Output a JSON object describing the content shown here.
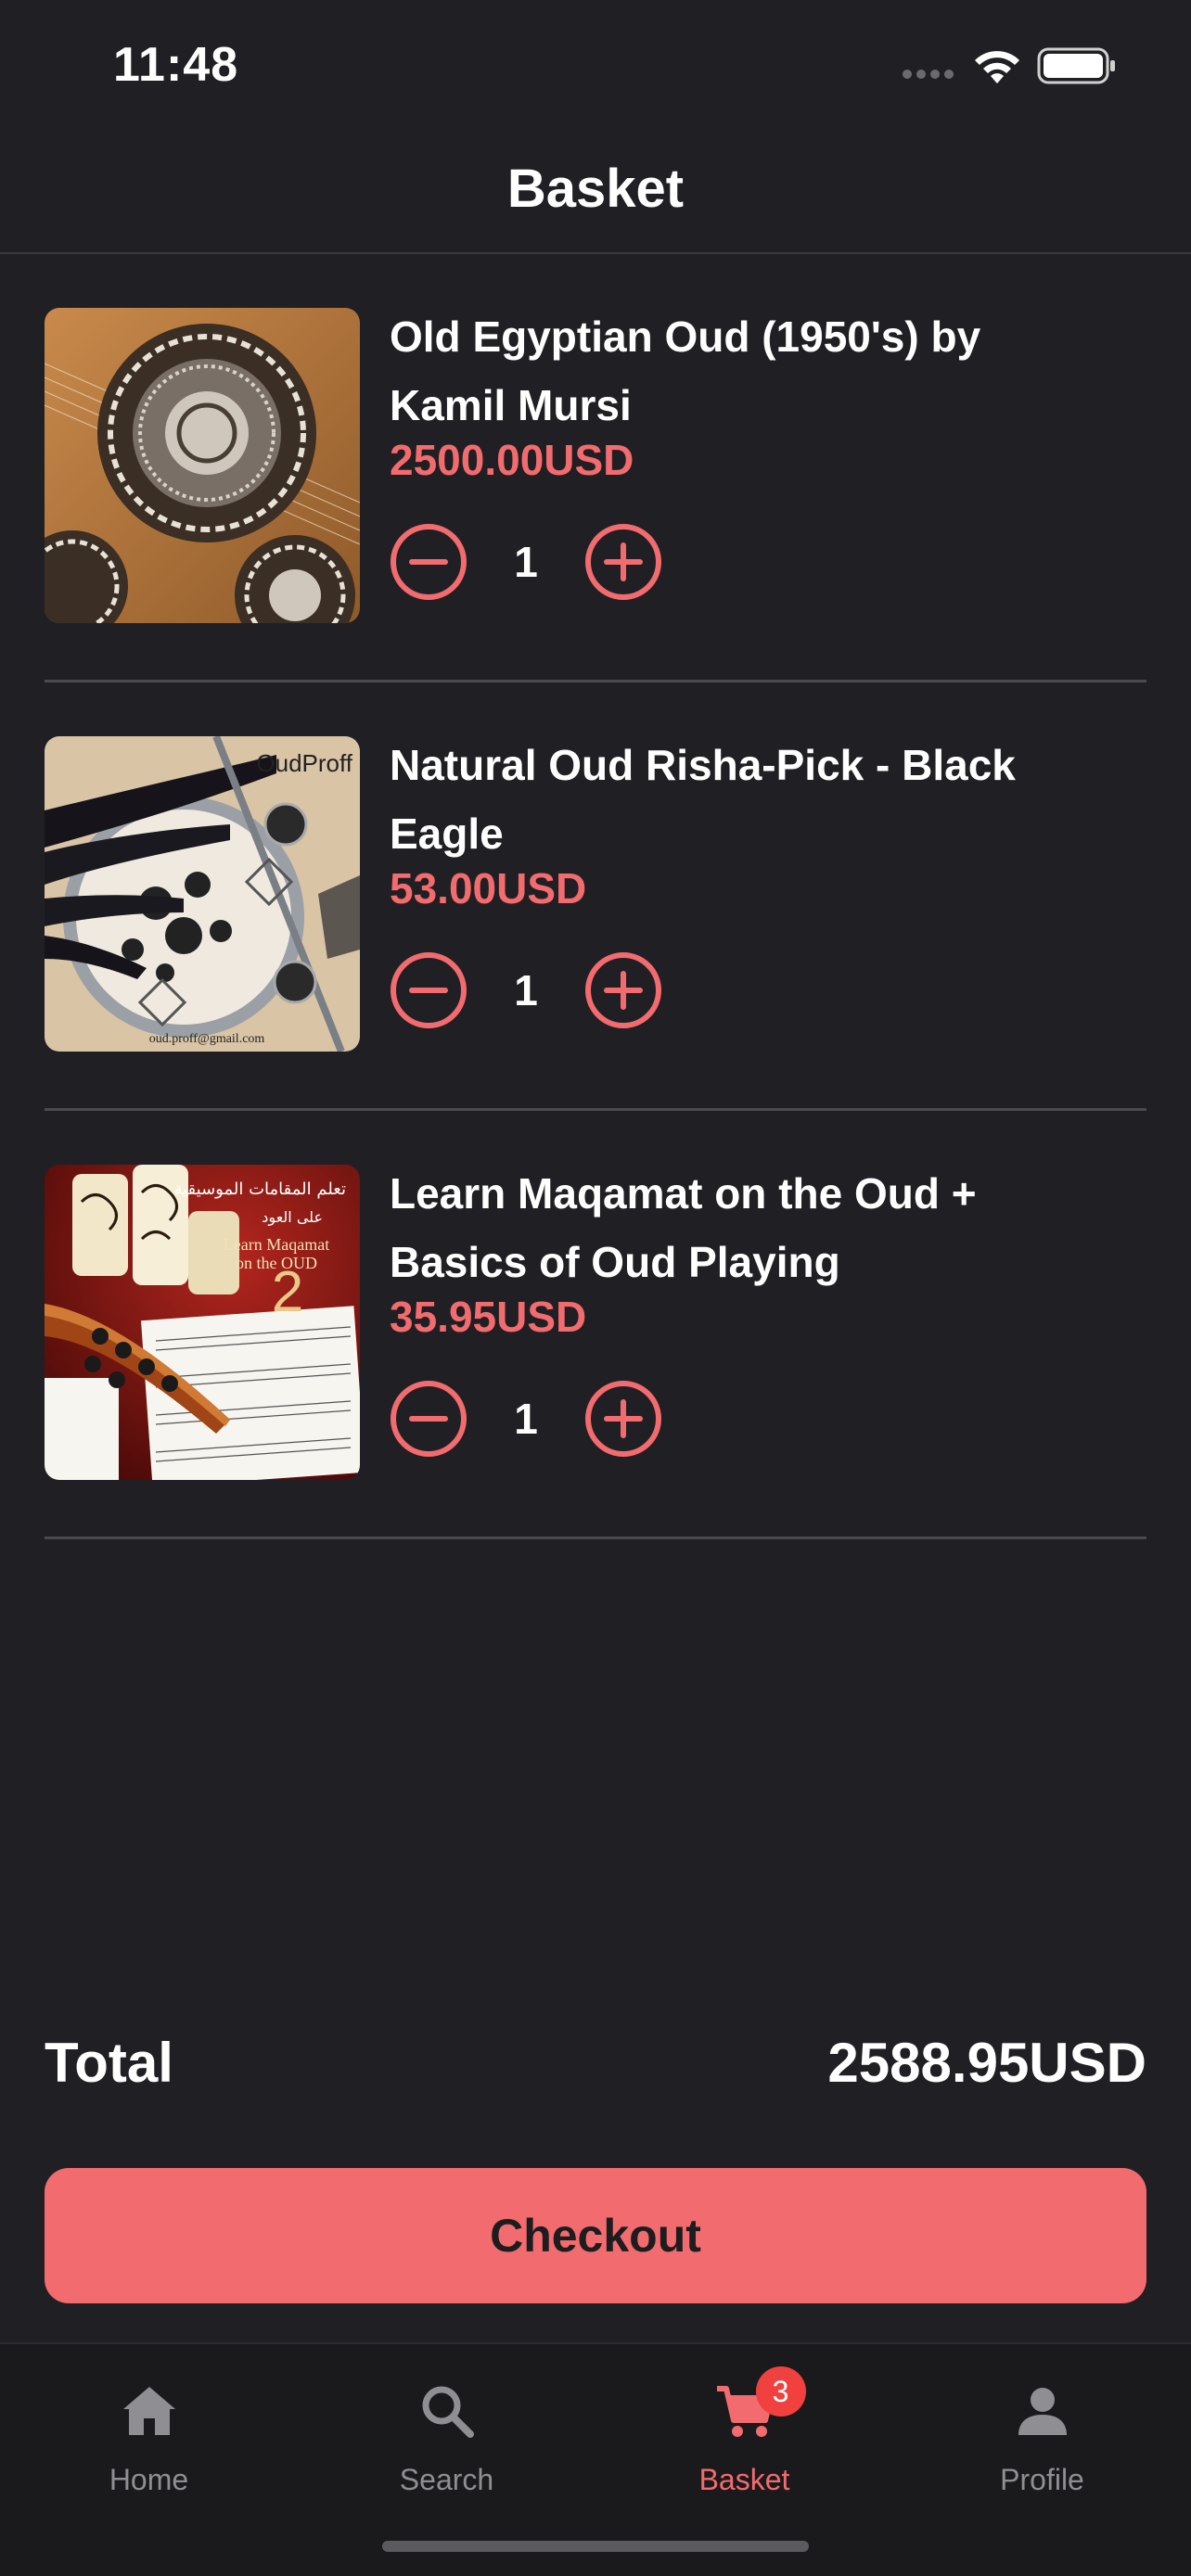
{
  "status_bar": {
    "time": "11:48",
    "icons": [
      "cellular-signal-icon",
      "wifi-icon",
      "battery-icon"
    ]
  },
  "header": {
    "title": "Basket"
  },
  "items": [
    {
      "title": "Old Egyptian Oud (1950's) by Kamil Mursi",
      "price": "2500.00USD",
      "quantity": "1",
      "image": "oud-inlay-photo"
    },
    {
      "title": "Natural Oud Risha-Pick - Black Eagle",
      "price": "53.00USD",
      "quantity": "1",
      "image": "risha-pick-photo",
      "image_watermark": "OudProff",
      "image_caption": "oud.proff@gmail.com"
    },
    {
      "title": "Learn Maqamat on the Oud + Basics of Oud Playing",
      "price": "35.95USD",
      "quantity": "1",
      "image": "maqamat-book-cover",
      "image_text_arabic_1": "تعلم المقامات الموسيقية",
      "image_text_arabic_2": "على العود",
      "image_text_line1": "Learn Maqamat",
      "image_text_line2": "on the OUD",
      "image_number": "2"
    }
  ],
  "total": {
    "label": "Total",
    "value": "2588.95USD"
  },
  "checkout": {
    "label": "Checkout"
  },
  "tabs": [
    {
      "label": "Home",
      "icon": "home-icon",
      "active": false
    },
    {
      "label": "Search",
      "icon": "search-icon",
      "active": false
    },
    {
      "label": "Basket",
      "icon": "cart-icon",
      "active": true,
      "badge": "3"
    },
    {
      "label": "Profile",
      "icon": "person-icon",
      "active": false
    }
  ],
  "colors": {
    "background": "#202024",
    "accent": "#f26b6e",
    "tab_inactive": "#8e8e93",
    "badge": "#f0413f"
  }
}
